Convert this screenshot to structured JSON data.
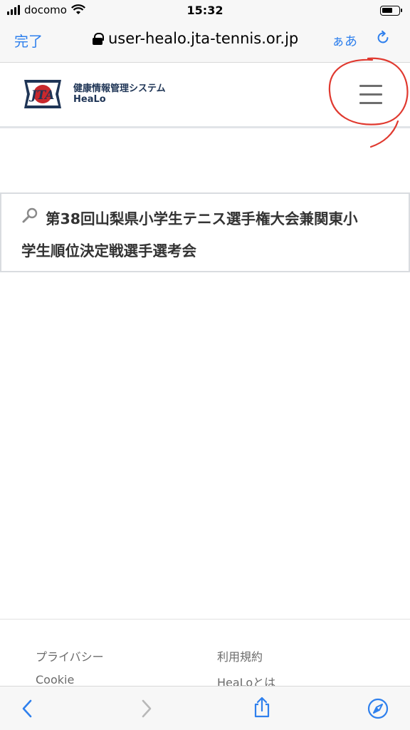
{
  "status_bar": {
    "carrier": "docomo",
    "time": "15:32"
  },
  "browser": {
    "done_label": "完了",
    "url": "user-healo.jta-tennis.or.jp",
    "text_size_label": "ぁあ"
  },
  "site": {
    "logo_text": "JTA",
    "brand_title": "健康情報管理システム",
    "brand_subtitle": "HeaLo"
  },
  "main": {
    "title_line1": "第38回山梨県小学生テニス選手権大会兼関東小",
    "title_line2": "学生順位決定戦選手選考会"
  },
  "footer": {
    "links": [
      "プライバシー",
      "利用規約",
      "Cookie",
      "HeaLoとは"
    ]
  },
  "colors": {
    "ios_blue": "#2f80ed",
    "brand_navy": "#1f3556",
    "annotation_red": "#e0392f"
  }
}
